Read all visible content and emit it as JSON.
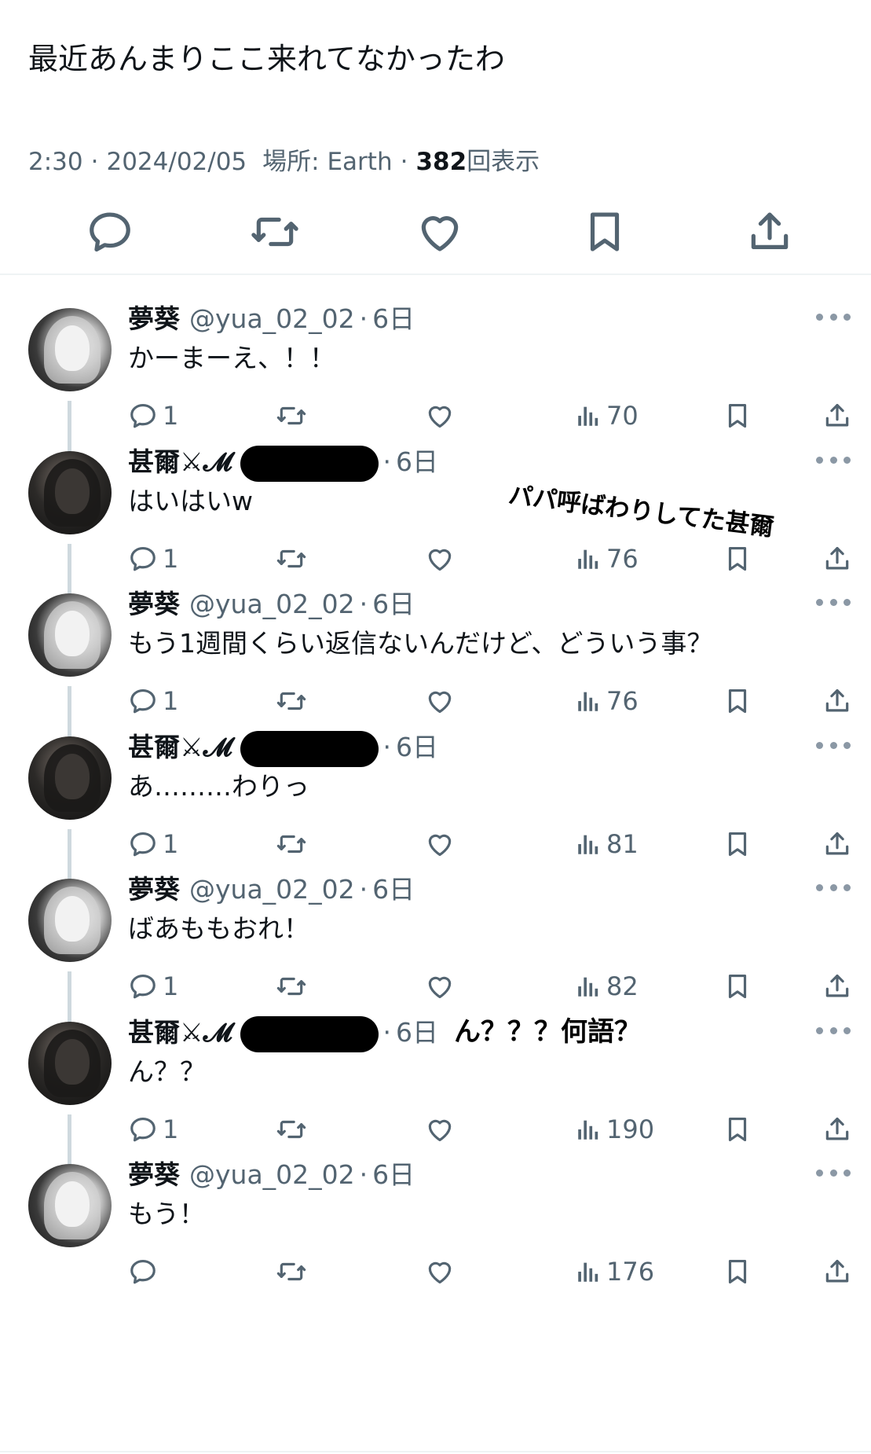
{
  "post": {
    "text": "最近あんまりここ来れてなかったわ",
    "time": "2:30",
    "date": "2024/02/05",
    "location_label": "場所: Earth",
    "views_count": "382",
    "views_label": "回表示"
  },
  "replies": [
    {
      "user": "yua",
      "name": "夢葵",
      "handle": "@yua_02_02",
      "time": "6日",
      "text": "かーまーえ、！！",
      "reply_count": "1",
      "views": "70",
      "redacted": false
    },
    {
      "user": "jin",
      "name": "甚爾⚔︎𝓜",
      "handle": "",
      "time": "6日",
      "text": "はいはいw",
      "reply_count": "1",
      "views": "76",
      "redacted": true
    },
    {
      "user": "yua",
      "name": "夢葵",
      "handle": "@yua_02_02",
      "time": "6日",
      "text": "もう1週間くらい返信ないんだけど、どういう事？",
      "reply_count": "1",
      "views": "76",
      "redacted": false
    },
    {
      "user": "jin",
      "name": "甚爾⚔︎𝓜",
      "handle": "",
      "time": "6日",
      "text": "あ………わりっ",
      "reply_count": "1",
      "views": "81",
      "redacted": true
    },
    {
      "user": "yua",
      "name": "夢葵",
      "handle": "@yua_02_02",
      "time": "6日",
      "text": "ばあももおれ！",
      "reply_count": "1",
      "views": "82",
      "redacted": false
    },
    {
      "user": "jin",
      "name": "甚爾⚔︎𝓜",
      "handle": "",
      "time": "6日",
      "text": "ん？？",
      "reply_count": "1",
      "views": "190",
      "redacted": true
    },
    {
      "user": "yua",
      "name": "夢葵",
      "handle": "@yua_02_02",
      "time": "6日",
      "text": "もう！",
      "reply_count": "",
      "views": "176",
      "redacted": false
    }
  ],
  "annotations": {
    "papa": "パパ呼ばわりしてた甚爾",
    "nanigo": "ん？？？何語？"
  },
  "colors": {
    "text_primary": "#0f1419",
    "text_secondary": "#536471",
    "divider": "#eff3f4",
    "thread_line": "#cfd9de"
  },
  "icons": {
    "reply": "speech-bubble-icon",
    "repost": "repost-arrows-icon",
    "like": "heart-icon",
    "bookmark": "bookmark-icon",
    "share": "share-upload-icon",
    "views": "bar-chart-icon",
    "more": "ellipsis-icon"
  }
}
